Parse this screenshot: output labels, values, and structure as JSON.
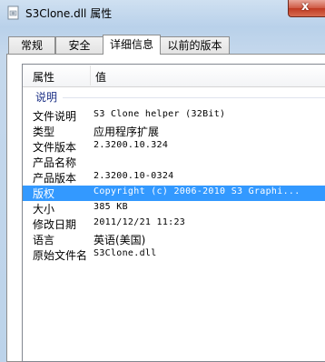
{
  "window": {
    "title": "S3Clone.dll 属性",
    "close_glyph": "x"
  },
  "tabs": [
    {
      "label": "常规"
    },
    {
      "label": "安全"
    },
    {
      "label": "详细信息",
      "active": true
    },
    {
      "label": "以前的版本"
    }
  ],
  "details": {
    "columns": [
      "属性",
      "值"
    ],
    "group": "说明",
    "rows": [
      {
        "key": "文件说明",
        "value": "S3 Clone helper (32Bit)"
      },
      {
        "key": "类型",
        "value": "应用程序扩展"
      },
      {
        "key": "文件版本",
        "value": "2.3200.10.324"
      },
      {
        "key": "产品名称",
        "value": ""
      },
      {
        "key": "产品版本",
        "value": "2.3200.10-0324"
      },
      {
        "key": "版权",
        "value": "Copyright (c) 2006-2010 S3 Graphi...",
        "selected": true
      },
      {
        "key": "大小",
        "value": "385 KB"
      },
      {
        "key": "修改日期",
        "value": "2011/12/21 11:23"
      },
      {
        "key": "语言",
        "value": "英语(美国)"
      },
      {
        "key": "原始文件名",
        "value": "S3Clone.dll"
      }
    ]
  },
  "colors": {
    "selection": "#3399ff",
    "group_label": "#1e3287"
  }
}
